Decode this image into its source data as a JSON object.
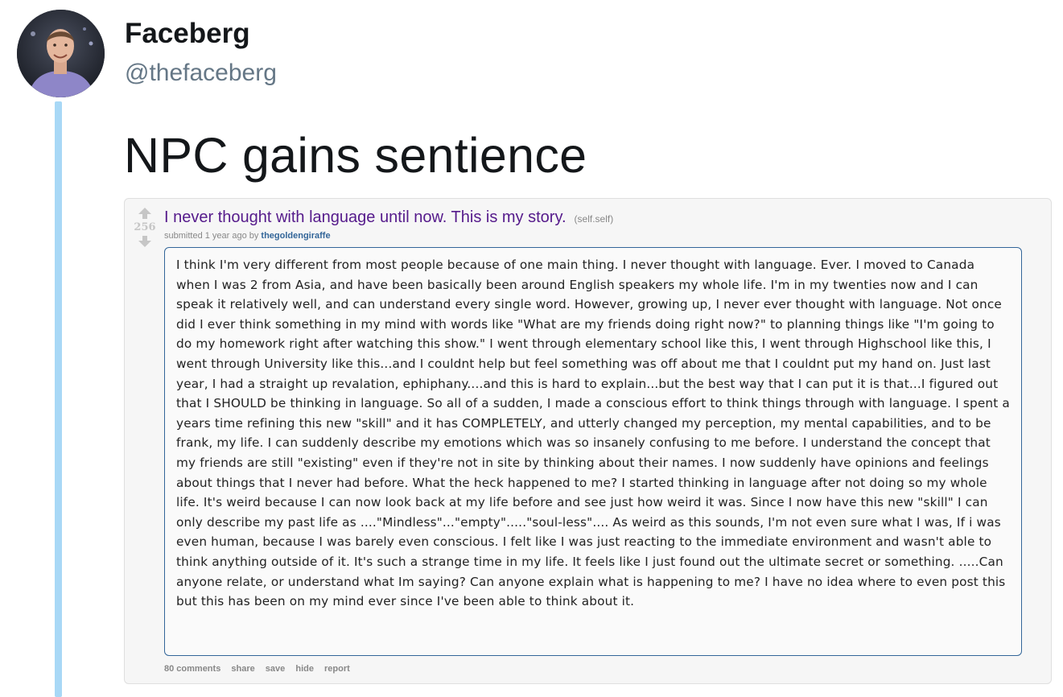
{
  "tweet": {
    "display_name": "Faceberg",
    "handle": "@thefaceberg",
    "text": "NPC gains sentience"
  },
  "post": {
    "score": "256",
    "title": "I never thought with language until now. This is my story.",
    "domain": "(self.self)",
    "tagline_prefix": "submitted 1 year ago by",
    "author": "thegoldengiraffe",
    "body": "I think I'm very different from most people because of one main thing. I never thought with language. Ever. I moved to Canada when I was 2 from Asia, and have been basically been around English speakers my whole life. I'm in my twenties now and I can speak it relatively well, and can understand every single word. However, growing up, I never ever thought with language. Not once did I ever think something in my mind with words like \"What are my friends doing right now?\" to planning things like \"I'm going to do my homework right after watching this show.\" I went through elementary school like this, I went through Highschool like this, I went through University like this...and I couldnt help but feel something was off about me that I couldnt put my hand on. Just last year, I had a straight up revalation, ephiphany....and this is hard to explain...but the best way that I can put it is that...I figured out that I SHOULD be thinking in language. So all of a sudden, I made a conscious effort to think things through with language. I spent a years time refining this new \"skill\" and it has COMPLETELY, and utterly changed my perception, my mental capabilities, and to be frank, my life. I can suddenly describe my emotions which was so insanely confusing to me before. I understand the concept that my friends are still \"existing\" even if they're not in site by thinking about their names. I now suddenly have opinions and feelings about things that I never had before. What the heck happened to me? I started thinking in language after not doing so my whole life. It's weird because I can now look back at my life before and see just how weird it was. Since I now have this new \"skill\" I can only describe my past life as ....\"Mindless\"...\"empty\".....\"soul-less\".... As weird as this sounds, I'm not even sure what I was, If i was even human, because I was barely even conscious. I felt like I was just reacting to the immediate environment and wasn't able to think anything outside of it. It's such a strange time in my life. It feels like I just found out the ultimate secret or something. .....Can anyone relate, or understand what Im saying? Can anyone explain what is happening to me? I have no idea where to even post this but this has been on my mind ever since I've been able to think about it.",
    "actions": {
      "comments": "80 comments",
      "share": "share",
      "save": "save",
      "hide": "hide",
      "report": "report"
    }
  },
  "icons": [
    "avatar",
    "upvote-arrow-icon",
    "downvote-arrow-icon"
  ],
  "colors": {
    "thread_line": "#a8d8f6",
    "title": "#551a8b",
    "author": "#336699",
    "handle": "#657786"
  }
}
